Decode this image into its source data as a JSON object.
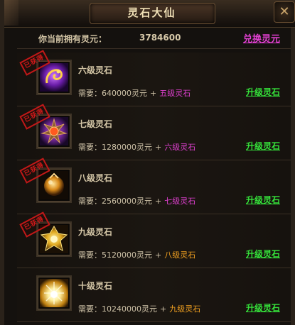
{
  "window": {
    "title": "灵石大仙",
    "close_icon": "close-icon"
  },
  "header": {
    "owned_label": "你当前拥有灵元：",
    "owned_value": "3784600",
    "exchange_label": "兑换灵元"
  },
  "stamp_text": "已获得",
  "colors": {
    "purple_req": "#e040d0",
    "orange_req": "#f0a020",
    "upgrade": "#35e23a",
    "stamp": "#d11a1a"
  },
  "stones": [
    {
      "name": "六级灵石",
      "need_label": "需要：",
      "amount": "640000灵元",
      "plus": "+",
      "requires": "五级灵石",
      "requires_color": "#e040d0",
      "upgrade_label": "升级灵石",
      "obtained": true,
      "icon": "dragon-orb-icon"
    },
    {
      "name": "七级灵石",
      "need_label": "需要：",
      "amount": "1280000灵元",
      "plus": "+",
      "requires": "六级灵石",
      "requires_color": "#e040d0",
      "upgrade_label": "升级灵石",
      "obtained": true,
      "icon": "spiked-orb-icon"
    },
    {
      "name": "八级灵石",
      "need_label": "需要：",
      "amount": "2560000灵元",
      "plus": "+",
      "requires": "七级灵石",
      "requires_color": "#e040d0",
      "upgrade_label": "升级灵石",
      "obtained": true,
      "icon": "amber-orb-icon"
    },
    {
      "name": "九级灵石",
      "need_label": "需要：",
      "amount": "5120000灵元",
      "plus": "+",
      "requires": "八级灵石",
      "requires_color": "#f0a020",
      "upgrade_label": "升级灵石",
      "obtained": true,
      "icon": "golden-emblem-icon"
    },
    {
      "name": "十级灵石",
      "need_label": "需要：",
      "amount": "10240000灵元",
      "plus": "+",
      "requires": "九级灵石",
      "requires_color": "#f0a020",
      "upgrade_label": "升级灵石",
      "obtained": false,
      "icon": "radiant-light-icon"
    }
  ]
}
